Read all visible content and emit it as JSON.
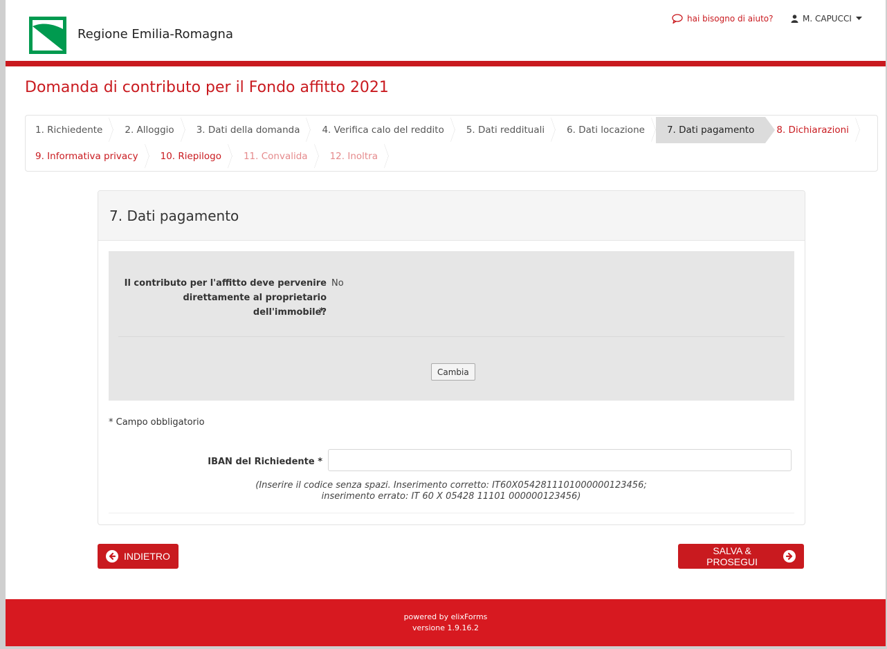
{
  "header": {
    "brand": "Regione Emilia-Romagna",
    "help_label": "hai bisogno di aiuto?",
    "user_name": "M. CAPUCCI"
  },
  "page_title": "Domanda di contributo per il Fondo affitto 2021",
  "steps": [
    {
      "label": "1. Richiedente",
      "state": "done"
    },
    {
      "label": "2. Alloggio",
      "state": "done"
    },
    {
      "label": "3. Dati della domanda",
      "state": "done"
    },
    {
      "label": "4. Verifica calo del reddito",
      "state": "done"
    },
    {
      "label": "5. Dati reddituali",
      "state": "done"
    },
    {
      "label": "6. Dati locazione",
      "state": "done"
    },
    {
      "label": "7. Dati pagamento",
      "state": "active"
    },
    {
      "label": "8. Dichiarazioni",
      "state": "todo"
    },
    {
      "label": "9. Informativa privacy",
      "state": "todo"
    },
    {
      "label": "10. Riepilogo",
      "state": "todo"
    },
    {
      "label": "11. Convalida",
      "state": "disabled"
    },
    {
      "label": "12. Inoltra",
      "state": "disabled"
    }
  ],
  "panel": {
    "title": "7. Dati pagamento",
    "owner_question_line1": "Il contributo per l'affitto deve pervenire",
    "owner_question_line2": "direttamente al proprietario dell'immobile?",
    "owner_required_mark": "*",
    "owner_answer": "No",
    "change_button": "Cambia",
    "required_note": "* Campo obbligatorio",
    "iban_label": "IBAN del Richiedente *",
    "iban_value": "",
    "iban_placeholder": "",
    "iban_help_line1": "(Inserire il codice senza spazi. Inserimento corretto: IT60X0542811101000000123456;",
    "iban_help_line2": "inserimento errato: IT 60 X 05428 11101 000000123456)"
  },
  "buttons": {
    "back": "INDIETRO",
    "save": "SALVA & PROSEGUI"
  },
  "footer": {
    "line1": "powered by elixForms",
    "line2": "versione 1.9.16.2"
  },
  "colors": {
    "brand_red": "#c91a1f",
    "footer_red": "#d71920",
    "logo_green": "#009a4f"
  }
}
